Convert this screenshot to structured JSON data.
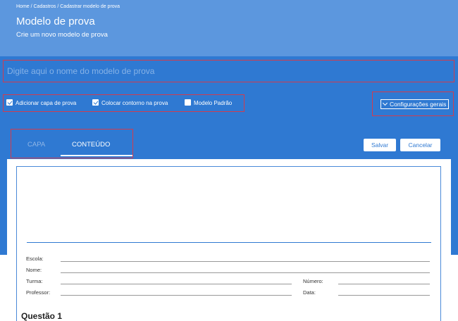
{
  "header": {
    "breadcrumb": "Home / Cadastros / Cadastrar modelo de prova",
    "title": "Modelo de prova",
    "subtitle": "Crie um novo modelo de prova"
  },
  "name_input": {
    "placeholder": "Digite aqui o nome do modelo de prova",
    "value": ""
  },
  "options": [
    {
      "label": "Adicionar capa de prova",
      "checked": true
    },
    {
      "label": "Colocar contorno na prova",
      "checked": true
    },
    {
      "label": "Modelo Padrão",
      "checked": false
    }
  ],
  "config_button": "Configurações gerais",
  "tabs": [
    {
      "label": "CAPA",
      "active": false
    },
    {
      "label": "CONTEÚDO",
      "active": true
    }
  ],
  "actions": {
    "save": "Salvar",
    "cancel": "Cancelar"
  },
  "form_fields": {
    "school": "Escola:",
    "name": "Nome:",
    "class": "Turma:",
    "number": "Número:",
    "teacher": "Professor:",
    "date": "Data:"
  },
  "question_title": "Questão 1",
  "colors": {
    "header_bg": "#5c97de",
    "primary": "#2f79d2",
    "highlight_border": "#d23c4e"
  }
}
